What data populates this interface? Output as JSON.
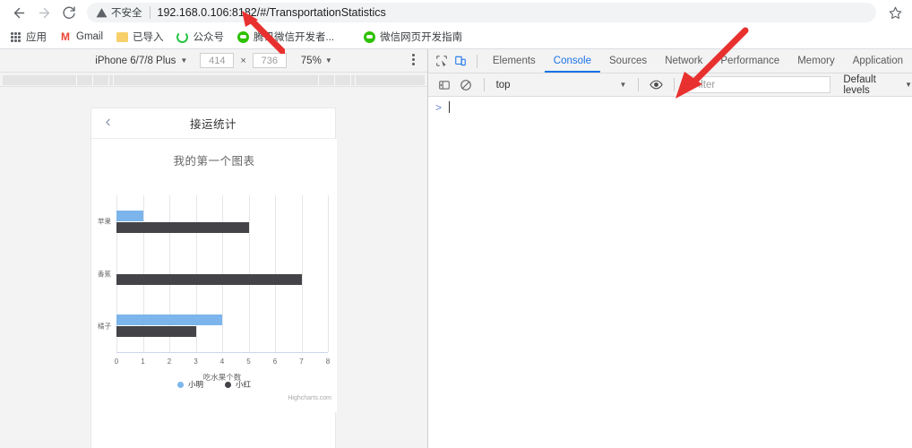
{
  "browser": {
    "back_icon": "arrow-left-icon",
    "forward_icon": "arrow-right-icon",
    "reload_icon": "reload-icon",
    "security_label": "不安全",
    "security_icon": "warning-triangle-icon",
    "url": "192.168.0.106:8182/#/TransportationStatistics",
    "bookmark_star_icon": "star-icon"
  },
  "bookmarks": [
    {
      "icon": "apps-grid-icon",
      "label": "应用"
    },
    {
      "icon": "gmail-icon",
      "label": "Gmail"
    },
    {
      "icon": "folder-icon",
      "label": "已导入"
    },
    {
      "icon": "refresh-circle-icon",
      "label": "公众号"
    },
    {
      "icon": "wechat-icon",
      "label": "腾讯微信开发者..."
    },
    {
      "icon": "wechat-icon",
      "label": "微信网页开发指南"
    }
  ],
  "device_toolbar": {
    "device": "iPhone 6/7/8 Plus",
    "width": "414",
    "height": "736",
    "times": "×",
    "zoom": "75%",
    "more_icon": "kebab-menu-icon"
  },
  "phone": {
    "back_icon": "chevron-left-icon",
    "title": "接运统计"
  },
  "chart_data": {
    "type": "bar",
    "title": "我的第一个图表",
    "xlabel": "吃水果个数",
    "ylabel": "",
    "categories": [
      "苹果",
      "香蕉",
      "橘子"
    ],
    "series": [
      {
        "name": "小明",
        "color": "#7cb5ec",
        "values": [
          1,
          0,
          4
        ]
      },
      {
        "name": "小红",
        "color": "#434348",
        "values": [
          5,
          7,
          3
        ]
      }
    ],
    "xticks": [
      "0",
      "1",
      "2",
      "3",
      "4",
      "5",
      "6",
      "7",
      "8"
    ],
    "xlim": [
      0,
      8
    ],
    "grid": true,
    "legend_position": "bottom",
    "credits": "Highcharts.com"
  },
  "devtools": {
    "inspect_icon": "inspect-element-icon",
    "device_toggle_icon": "device-toolbar-icon",
    "tabs": [
      {
        "label": "Elements",
        "active": false
      },
      {
        "label": "Console",
        "active": true
      },
      {
        "label": "Sources",
        "active": false
      },
      {
        "label": "Network",
        "active": false
      },
      {
        "label": "Performance",
        "active": false
      },
      {
        "label": "Memory",
        "active": false
      },
      {
        "label": "Application",
        "active": false
      }
    ],
    "console_toolbar": {
      "sidebar_icon": "console-sidebar-icon",
      "clear_icon": "clear-console-icon",
      "context": "top",
      "eye_icon": "live-expression-icon",
      "filter_placeholder": "Filter",
      "levels": "Default levels"
    },
    "prompt": ">"
  },
  "annotations": {
    "arrow_color": "#e8312f",
    "arrow1_name": "red-arrow-url",
    "arrow2_name": "red-arrow-console"
  }
}
